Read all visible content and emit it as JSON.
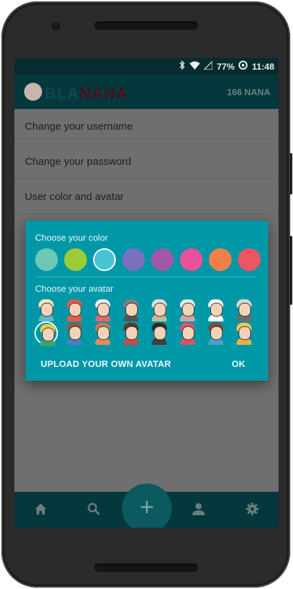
{
  "status_bar": {
    "battery": "77%",
    "time": "11:48"
  },
  "app_bar": {
    "logo_part1": "BLA",
    "logo_part2": "NANA",
    "credits": "166 NANA"
  },
  "menu": {
    "items": [
      {
        "label": "Change your username"
      },
      {
        "label": "Change your password"
      },
      {
        "label": "User color and avatar"
      }
    ]
  },
  "dialog": {
    "color_title": "Choose your color",
    "avatar_title": "Choose your avatar",
    "colors": [
      {
        "hex": "#6cc7b5",
        "selected": false
      },
      {
        "hex": "#9ccb3a",
        "selected": false
      },
      {
        "hex": "#47c3d6",
        "selected": true
      },
      {
        "hex": "#7b70bd",
        "selected": false
      },
      {
        "hex": "#a158a8",
        "selected": false
      },
      {
        "hex": "#e8529b",
        "selected": false
      },
      {
        "hex": "#f17f48",
        "selected": false
      },
      {
        "hex": "#ed5562",
        "selected": false
      }
    ],
    "avatars": [
      {
        "name": "avatar-1",
        "hair": "#f5e6b3",
        "body": "#5fb7c7",
        "selected": false
      },
      {
        "name": "avatar-2",
        "hair": "#e5584e",
        "body": "#e5584e",
        "selected": false
      },
      {
        "name": "avatar-3",
        "hair": "#eeeeee",
        "body": "#d96a6a",
        "selected": false
      },
      {
        "name": "avatar-4",
        "hair": "#7f7f7f",
        "body": "#555555",
        "selected": false
      },
      {
        "name": "avatar-5",
        "hair": "#dddddd",
        "body": "#c9b79a",
        "selected": false
      },
      {
        "name": "avatar-6",
        "hair": "#e6e6e6",
        "body": "#d2a6a6",
        "selected": false
      },
      {
        "name": "avatar-7",
        "hair": "#ffffff",
        "body": "#ffffff",
        "selected": false
      },
      {
        "name": "avatar-8",
        "hair": "#d8d8d8",
        "body": "#6b6b6b",
        "selected": false
      },
      {
        "name": "avatar-9",
        "hair": "#f0c84a",
        "body": "#3ba66a",
        "selected": true
      },
      {
        "name": "avatar-10",
        "hair": "#8a5a3a",
        "body": "#4d7fbf",
        "selected": false
      },
      {
        "name": "avatar-11",
        "hair": "#c87a4a",
        "body": "#e58c5a",
        "selected": false
      },
      {
        "name": "avatar-12",
        "hair": "#5b3a2a",
        "body": "#c74a4a",
        "selected": false
      },
      {
        "name": "avatar-13",
        "hair": "#2d2d2d",
        "body": "#3f3f3f",
        "selected": false
      },
      {
        "name": "avatar-14",
        "hair": "#d8536b",
        "body": "#d8536b",
        "selected": false
      },
      {
        "name": "avatar-15",
        "hair": "#7a4a3a",
        "body": "#4aa0c9",
        "selected": false
      },
      {
        "name": "avatar-16",
        "hair": "#f2c94c",
        "body": "#e7b24c",
        "selected": false
      }
    ],
    "upload_label": "UPLOAD YOUR OWN AVATAR",
    "ok_label": "OK"
  },
  "bottom_nav": {
    "icons": [
      "home-icon",
      "search-icon",
      "add-icon",
      "profile-icon",
      "settings-icon"
    ],
    "fab_symbol": "+"
  }
}
